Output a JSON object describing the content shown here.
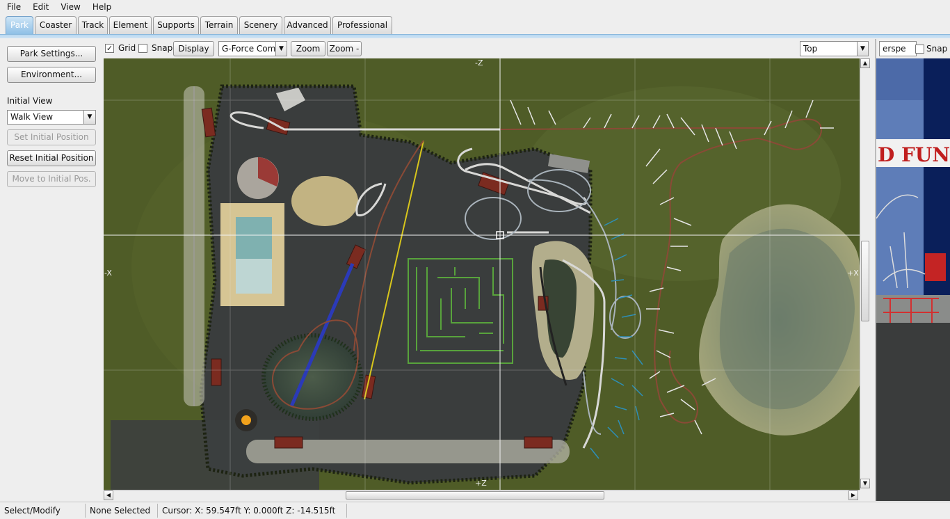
{
  "menu": [
    "File",
    "Edit",
    "View",
    "Help"
  ],
  "tabs": [
    "Park",
    "Coaster",
    "Track",
    "Element",
    "Supports",
    "Terrain",
    "Scenery",
    "Advanced",
    "Professional"
  ],
  "active_tab": "Park",
  "left_panel": {
    "park_settings": "Park Settings...",
    "environment": "Environment...",
    "initial_view_label": "Initial View",
    "initial_view_value": "Walk View",
    "set_initial_position": "Set Initial Position",
    "reset_initial_position": "Reset Initial Position",
    "move_to_initial": "Move to Initial Pos."
  },
  "editor_toolbar": {
    "grid_label": "Grid",
    "grid_checked": true,
    "snap_label": "Snap",
    "snap_checked": false,
    "display_button": "Display",
    "gforce_value": "G-Force Coml",
    "zoom_in": "Zoom +",
    "zoom_out": "Zoom -",
    "view_value": "Top"
  },
  "map": {
    "axis_top": "-Z",
    "axis_bottom": "+Z",
    "axis_left": "-X",
    "axis_right": "+X",
    "colors": {
      "grass": "#4f5c27",
      "path": "#3a3d3d",
      "sand": "#d2c08a",
      "water": "#5a6e60",
      "maze": "#58a33c"
    }
  },
  "preview": {
    "view_value": "erspe",
    "snap_label": "Snap",
    "sign_text": "D FUN"
  },
  "status": {
    "mode": "Select/Modify",
    "selection": "None Selected",
    "cursor": "Cursor: X: 59.547ft Y: 0.000ft Z: -14.515ft"
  }
}
